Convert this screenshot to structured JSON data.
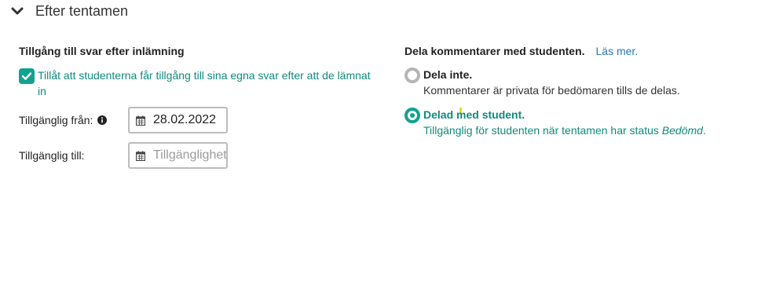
{
  "section": {
    "title": "Efter tentamen"
  },
  "access": {
    "title": "Tillgång till svar efter inlämning",
    "allow_checkbox_label": "Tillåt att studenterna får tillgång till sina egna svar efter att de lämnat in",
    "allow_checked": true,
    "available_from_label": "Tillgänglig från:",
    "available_from_value": "28.02.2022",
    "available_to_label": "Tillgänglig till:",
    "available_to_placeholder": "Tillgänglighet"
  },
  "comments": {
    "title": "Dela kommentarer med studenten.",
    "read_more": "Läs mer.",
    "options": [
      {
        "label": "Dela inte.",
        "desc": "Kommentarer är privata för bedömaren tills de delas.",
        "selected": false
      },
      {
        "label": "Delad med student.",
        "desc_prefix": "Tillgänglig för studenten när tentamen har status ",
        "desc_em": "Bedömd",
        "desc_suffix": ".",
        "selected": true
      }
    ]
  },
  "colors": {
    "accent": "#10a38f",
    "accent_text": "#0f8b7d",
    "link": "#2a77b8",
    "border": "#bdbdbd"
  },
  "icons": {
    "collapse": "chevron-down-icon",
    "checkbox": "check-icon",
    "info": "info-circle-icon",
    "calendar": "calendar-icon"
  }
}
